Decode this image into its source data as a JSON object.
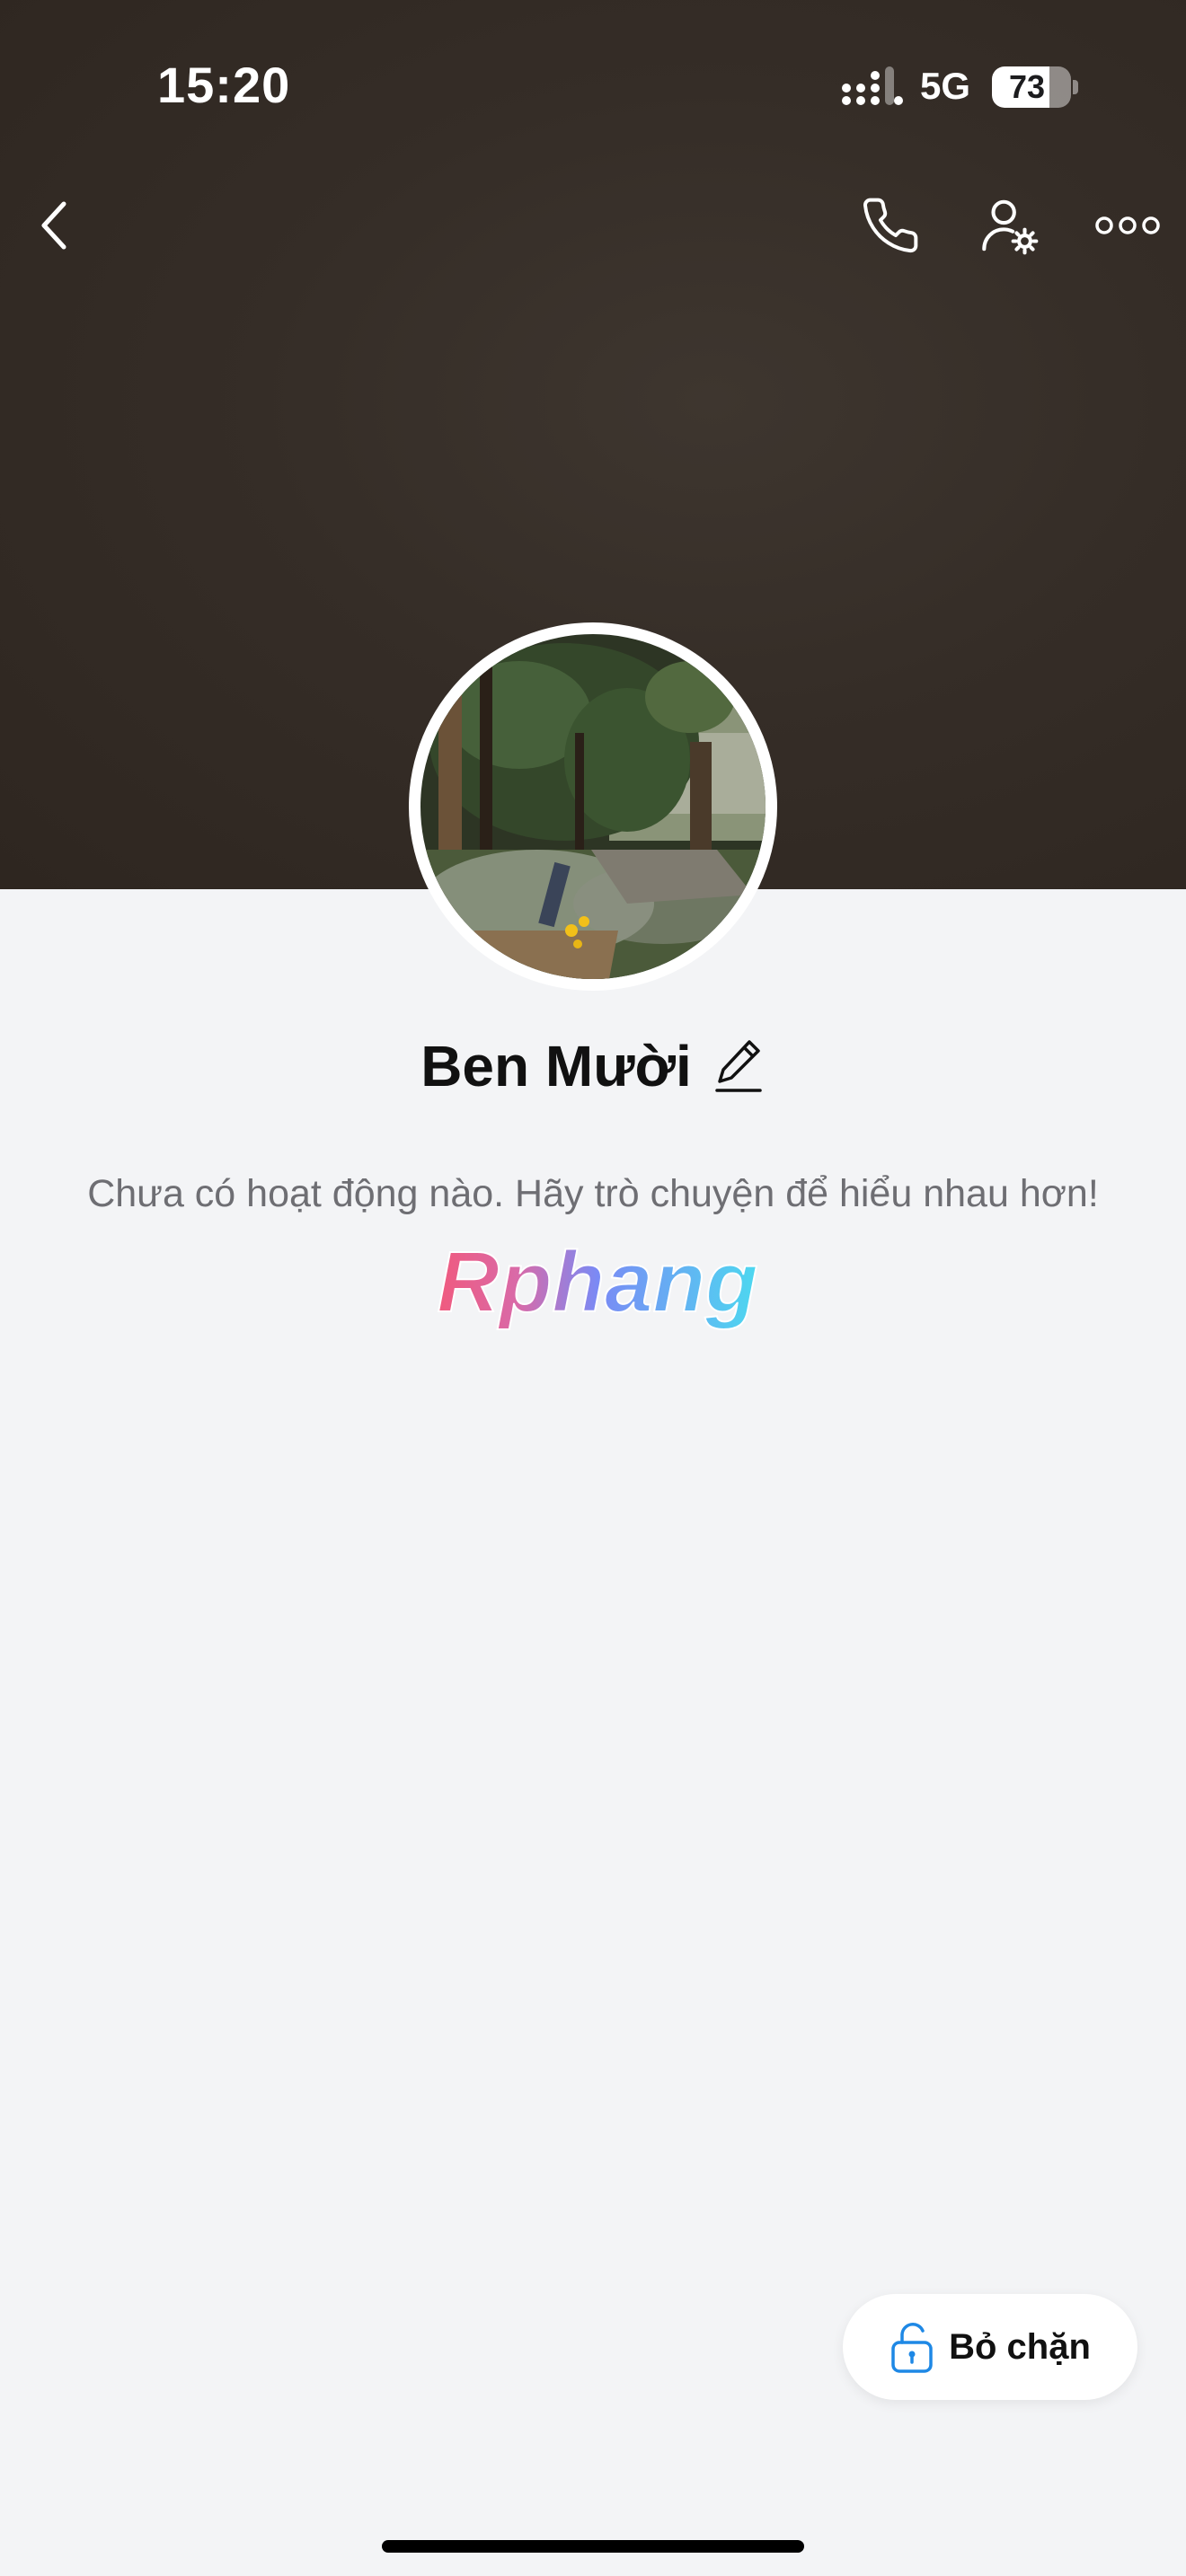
{
  "status_bar": {
    "time": "15:20",
    "network": "5G",
    "battery_level": 73,
    "battery_text": "73"
  },
  "header": {
    "icons": [
      "back-chevron-icon",
      "phone-icon",
      "user-settings-icon",
      "more-icon"
    ]
  },
  "profile": {
    "name": "Ben Mười",
    "activity_message": "Chưa có hoạt động nào. Hãy trò chuyện để hiểu nhau hơn!"
  },
  "watermark": {
    "text": "Rphang"
  },
  "actions": {
    "unblock_label": "Bỏ chặn",
    "unblock_icon": "unlock-icon"
  },
  "colors": {
    "accent": "#1e88e5",
    "cover": "#352d27",
    "background": "#f3f4f6"
  }
}
